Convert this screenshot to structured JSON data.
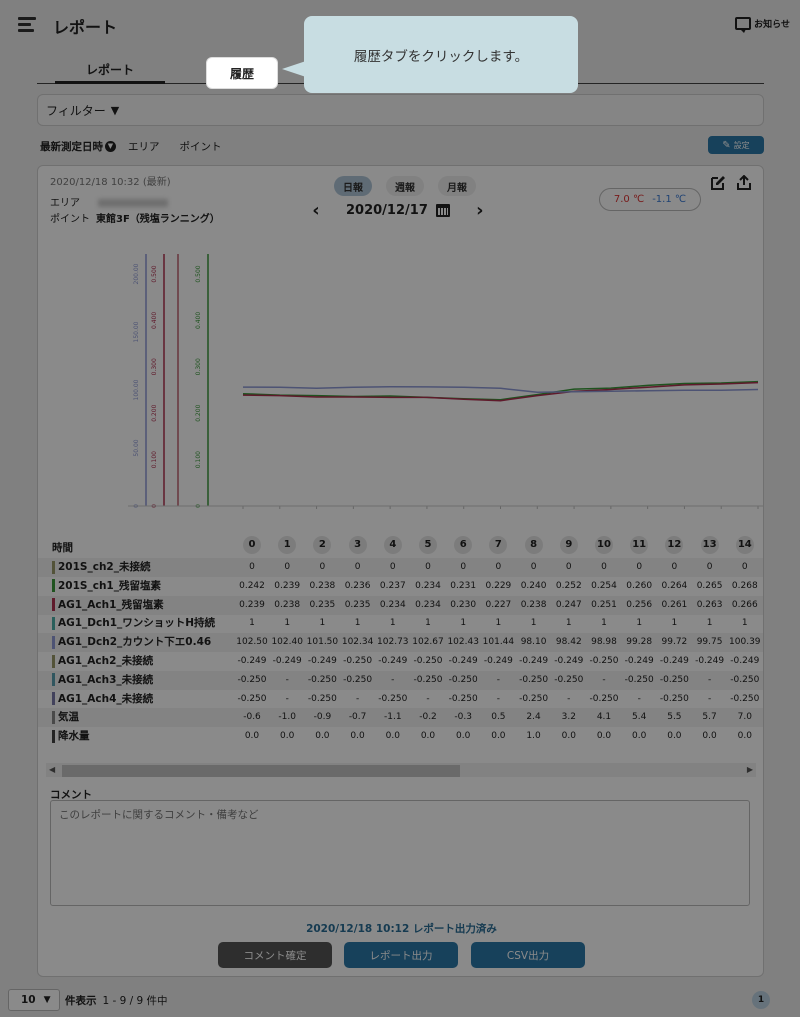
{
  "header": {
    "title": "レポート",
    "notice_label": "お知らせ"
  },
  "tabs": {
    "report": "レポート",
    "history": "履歴"
  },
  "tooltip": "履歴タブをクリックします。",
  "filter": {
    "label": "フィルター",
    "caret": "▼"
  },
  "sort": {
    "latest": "最新測定日時",
    "area": "エリア",
    "point": "ポイント",
    "settings": "設定"
  },
  "card": {
    "latest_date": "2020/12/18 10:32 (最新)",
    "area_label": "エリア",
    "point_label": "ポイント",
    "point_value": "東館3F（残塩ランニング）",
    "period_tabs": [
      "日報",
      "週報",
      "月報"
    ],
    "date": "2020/12/17",
    "temp_max": "7.0 ℃",
    "temp_min": "-1.1 ℃"
  },
  "chart_data": {
    "type": "line",
    "axes": [
      {
        "color": "#8e99d6",
        "ticks": [
          "0",
          "50.00",
          "100.00",
          "150.00",
          "200.00"
        ]
      },
      {
        "color": "#b03050",
        "ticks": [
          "0",
          "0.100",
          "0.200",
          "0.300",
          "0.400",
          "0.500"
        ]
      },
      {
        "color": "#c06070",
        "ticks": []
      },
      {
        "color": "#3a9a3a",
        "ticks": [
          "0",
          "0.100",
          "0.200",
          "0.300",
          "0.400",
          "0.500"
        ]
      }
    ],
    "x": [
      0,
      1,
      2,
      3,
      4,
      5,
      6,
      7,
      8,
      9,
      10,
      11,
      12,
      13,
      14
    ],
    "series": [
      {
        "color": "#3a9a3a",
        "values": [
          0.242,
          0.239,
          0.238,
          0.236,
          0.237,
          0.234,
          0.231,
          0.229,
          0.24,
          0.252,
          0.254,
          0.26,
          0.264,
          0.265,
          0.268
        ]
      },
      {
        "color": "#b03050",
        "values": [
          0.239,
          0.238,
          0.235,
          0.235,
          0.234,
          0.234,
          0.23,
          0.227,
          0.238,
          0.247,
          0.251,
          0.256,
          0.261,
          0.263,
          0.266
        ]
      },
      {
        "color": "#8e99d6",
        "values": [
          102.5,
          102.4,
          101.5,
          102.34,
          102.73,
          102.67,
          102.43,
          101.44,
          98.1,
          98.42,
          98.98,
          99.28,
          99.72,
          99.75,
          100.39
        ]
      }
    ]
  },
  "table": {
    "time_label": "時間",
    "hours": [
      "0",
      "1",
      "2",
      "3",
      "4",
      "5",
      "6",
      "7",
      "8",
      "9",
      "10",
      "11",
      "12",
      "13",
      "14"
    ],
    "rows": [
      {
        "label": "201S_ch2_未接続",
        "color": "#9a9a6a",
        "values": [
          "0",
          "0",
          "0",
          "0",
          "0",
          "0",
          "0",
          "0",
          "0",
          "0",
          "0",
          "0",
          "0",
          "0",
          "0"
        ]
      },
      {
        "label": "201S_ch1_残留塩素",
        "color": "#3a9a3a",
        "values": [
          "0.242",
          "0.239",
          "0.238",
          "0.236",
          "0.237",
          "0.234",
          "0.231",
          "0.229",
          "0.240",
          "0.252",
          "0.254",
          "0.260",
          "0.264",
          "0.265",
          "0.268"
        ]
      },
      {
        "label": "AG1_Ach1_残留塩素",
        "color": "#b03050",
        "values": [
          "0.239",
          "0.238",
          "0.235",
          "0.235",
          "0.234",
          "0.234",
          "0.230",
          "0.227",
          "0.238",
          "0.247",
          "0.251",
          "0.256",
          "0.261",
          "0.263",
          "0.266"
        ]
      },
      {
        "label": "AG1_Dch1_ワンショットH持続",
        "color": "#4ab0a8",
        "values": [
          "1",
          "1",
          "1",
          "1",
          "1",
          "1",
          "1",
          "1",
          "1",
          "1",
          "1",
          "1",
          "1",
          "1",
          "1"
        ]
      },
      {
        "label": "AG1_Dch2_カウント下エ0.46",
        "color": "#8e99d6",
        "values": [
          "102.50",
          "102.40",
          "101.50",
          "102.34",
          "102.73",
          "102.67",
          "102.43",
          "101.44",
          "98.10",
          "98.42",
          "98.98",
          "99.28",
          "99.72",
          "99.75",
          "100.39"
        ]
      },
      {
        "label": "AG1_Ach2_未接続",
        "color": "#9a9a6a",
        "values": [
          "-0.249",
          "-0.249",
          "-0.249",
          "-0.250",
          "-0.249",
          "-0.250",
          "-0.249",
          "-0.249",
          "-0.249",
          "-0.249",
          "-0.250",
          "-0.249",
          "-0.249",
          "-0.249",
          "-0.249"
        ]
      },
      {
        "label": "AG1_Ach3_未接続",
        "color": "#5aa0b0",
        "values": [
          "-0.250",
          "-",
          "-0.250",
          "-0.250",
          "-",
          "-0.250",
          "-0.250",
          "-",
          "-0.250",
          "-0.250",
          "-",
          "-0.250",
          "-0.250",
          "-",
          "-0.250"
        ]
      },
      {
        "label": "AG1_Ach4_未接続",
        "color": "#7a7aaa",
        "values": [
          "-0.250",
          "-",
          "-0.250",
          "-",
          "-0.250",
          "-",
          "-0.250",
          "-",
          "-0.250",
          "-",
          "-0.250",
          "-",
          "-0.250",
          "-",
          "-0.250"
        ]
      },
      {
        "label": "気温",
        "color": "#888888",
        "values": [
          "-0.6",
          "-1.0",
          "-0.9",
          "-0.7",
          "-1.1",
          "-0.2",
          "-0.3",
          "0.5",
          "2.4",
          "3.2",
          "4.1",
          "5.4",
          "5.5",
          "5.7",
          "7.0"
        ]
      },
      {
        "label": "降水量",
        "color": "#444444",
        "values": [
          "0.0",
          "0.0",
          "0.0",
          "0.0",
          "0.0",
          "0.0",
          "0.0",
          "0.0",
          "1.0",
          "0.0",
          "0.0",
          "0.0",
          "0.0",
          "0.0",
          "0.0"
        ]
      }
    ]
  },
  "comment": {
    "label": "コメント",
    "placeholder": "このレポートに関するコメント・備考など"
  },
  "status": "2020/12/18 10:12 レポート出力済み",
  "buttons": {
    "comment": "コメント確定",
    "report": "レポート出力",
    "csv": "CSV出力"
  },
  "footer": {
    "page_size": "10",
    "per_page_label": "件表示",
    "range": "1 - 9 / 9 件中",
    "page": "1"
  }
}
